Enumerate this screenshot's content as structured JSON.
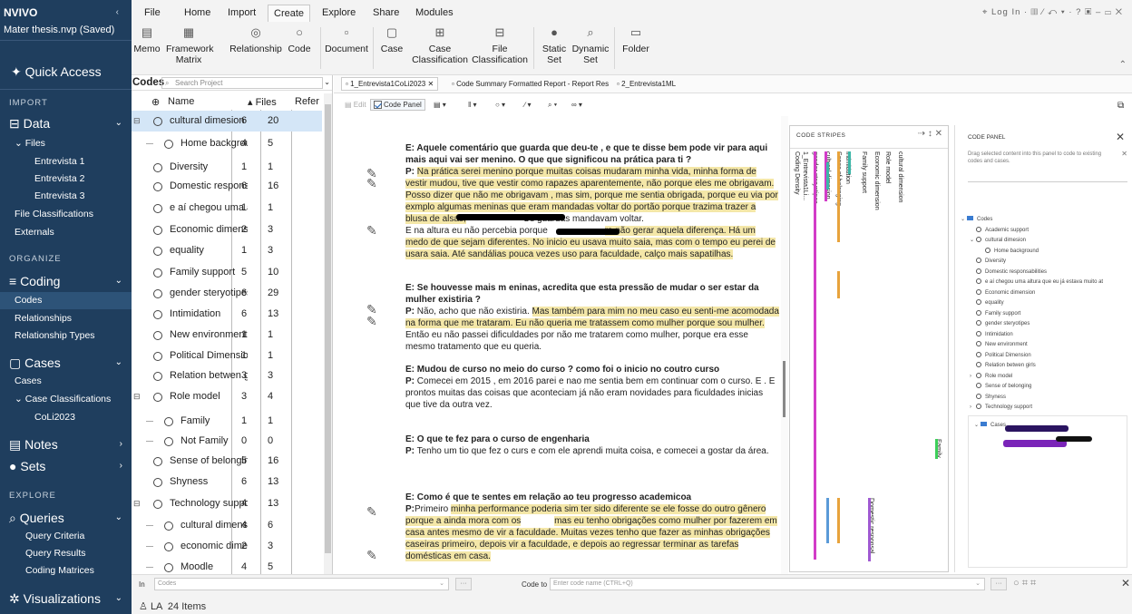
{
  "nav": {
    "logo": "NVIVO",
    "project": "Mater thesis.nvp (Saved)",
    "quick_access": "Quick Access",
    "sections": {
      "import": "IMPORT",
      "organize": "ORGANIZE",
      "explore": "EXPLORE"
    },
    "data": {
      "label": "Data",
      "files_label": "Files",
      "items": [
        "Entrevista 1",
        "Entrevista 2",
        "Entrevista 3"
      ],
      "file_classifications": "File Classifications",
      "externals": "Externals"
    },
    "coding": {
      "label": "Coding",
      "items": [
        "Codes",
        "Relationships",
        "Relationship Types"
      ]
    },
    "cases": {
      "label": "Cases",
      "items": [
        "Cases"
      ],
      "case_classifications": "Case Classifications",
      "sub": "CoLi2023"
    },
    "notes": "Notes",
    "sets": "Sets",
    "queries": {
      "label": "Queries",
      "items": [
        "Query Criteria",
        "Query Results",
        "Coding Matrices"
      ]
    },
    "visualizations": "Visualizations"
  },
  "ribbon": {
    "menus": [
      "File",
      "Home",
      "Import",
      "Create",
      "Explore",
      "Share",
      "Modules"
    ],
    "active_menu": "Create",
    "tools": [
      {
        "line1": "Memo",
        "line2": ""
      },
      {
        "line1": "Framework",
        "line2": "Matrix"
      },
      {
        "line1": "Relationship",
        "line2": ""
      },
      {
        "line1": "Code",
        "line2": ""
      },
      {
        "line1": "Document",
        "line2": ""
      },
      {
        "line1": "Case",
        "line2": ""
      },
      {
        "line1": "Case",
        "line2": "Classification"
      },
      {
        "line1": "File",
        "line2": "Classification"
      },
      {
        "line1": "Static",
        "line2": "Set"
      },
      {
        "line1": "Dynamic",
        "line2": "Set"
      },
      {
        "line1": "Folder",
        "line2": ""
      }
    ],
    "login": "Log In"
  },
  "codes": {
    "title": "Codes",
    "search_placeholder": "Search Project",
    "col_name": "Name",
    "col_files": "Files",
    "col_refs": "Refer",
    "rows": [
      {
        "name": "cultural dimesion",
        "files": "6",
        "refs": "20"
      },
      {
        "name": "Home backgrou",
        "files": "4",
        "refs": "5"
      },
      {
        "name": "Diversity",
        "files": "1",
        "refs": "1"
      },
      {
        "name": "Domestic responsab",
        "files": "6",
        "refs": "16"
      },
      {
        "name": "e aí chegou uma alt",
        "files": "1",
        "refs": "1"
      },
      {
        "name": "Economic dimension",
        "files": "2",
        "refs": "3"
      },
      {
        "name": "equality",
        "files": "1",
        "refs": "3"
      },
      {
        "name": "Family support",
        "files": "5",
        "refs": "10"
      },
      {
        "name": "gender steryotipes",
        "files": "6",
        "refs": "29"
      },
      {
        "name": "Intimidation",
        "files": "6",
        "refs": "13"
      },
      {
        "name": "New environment",
        "files": "1",
        "refs": "1"
      },
      {
        "name": "Political Dimension",
        "files": "1",
        "refs": "1"
      },
      {
        "name": "Relation betwen girl",
        "files": "3",
        "refs": "3"
      },
      {
        "name": "Role model",
        "files": "3",
        "refs": "4"
      },
      {
        "name": "Family",
        "files": "1",
        "refs": "1"
      },
      {
        "name": "Not Family",
        "files": "0",
        "refs": "0"
      },
      {
        "name": "Sense of belonging",
        "files": "5",
        "refs": "16"
      },
      {
        "name": "Shyness",
        "files": "6",
        "refs": "13"
      },
      {
        "name": "Technology support",
        "files": "4",
        "refs": "13"
      },
      {
        "name": "cultural dimensi",
        "files": "4",
        "refs": "6"
      },
      {
        "name": "economic dimen",
        "files": "2",
        "refs": "3"
      },
      {
        "name": "Moodle",
        "files": "4",
        "refs": "5"
      }
    ]
  },
  "doc_tabs": [
    "1_Entrevista1CoLi2023",
    "Code Summary Formatted Report - Report Res",
    "2_Entrevista1ML"
  ],
  "doc_toolbar": {
    "edit": "Edit",
    "code_panel": "Code Panel"
  },
  "document": [
    {
      "q": "E: Aquele comentário que guarda que deu-te , e que te disse bem pode vir para aqui mais aqui vai ser menino. O que que significou na prática para ti ?",
      "a_label": "P:",
      "a_hl": "Na prática serei menino porque muitas coisas mudaram minha vida, minha forma de vestir mudou, tive que vestir como rapazes aparentemente, não porque eles me obrigavam. Posso dizer que não me obrigavam , mas sim, porque me sentia obrigada, porque eu via por exmplo algumas meninas que eram mandadas voltar do portão porque trazima  trazer a blusa de alsas,",
      "a_tail": "Os guardas mandavam voltar."
    },
    {
      "a_pre": "E na altura eu não percebia porque",
      "a_hl": "ra não gerar aquela diferença. Há um medo de que sejam diferentes. No inicio eu usava muito saia, mas com o tempo eu perei de usara saia. Até sandálias pouca vezes uso para faculdade, calço mais sapatilhas."
    },
    {
      "q": "E: Se houvesse mais m eninas, acredita que esta pressão de mudar o ser estar da mulher existiria ?",
      "a_label": "P:",
      "a_pre": "Não, acho que não existiria.",
      "a_hl": "Mas também para mim no meu caso eu senti-me acomodada na forma que me trataram. Eu não queria me tratassem como mulher porque sou mulher.",
      "a_tail": "Então eu não passei dificuldades por não me tratarem como mulher, porque era esse mesmo tratamento que eu queria."
    },
    {
      "q": "E: Mudou de curso no meio do curso ? como foi o inicio no coutro curso",
      "a_label": "P:",
      "a_pre": "Comecei em 2015",
      "a_tail": ", em 2016 parei  e nao me sentia bem em continuar com o curso. E . E prontos muitas das coisas que aconteciam já não eram novidades para ficuldades inicias que tive da outra vez."
    },
    {
      "q": "E: O que te fez     para o curso de engenharia",
      "a_label": "P:",
      "a_tail": "Tenho um tio que fez  o curs e com ele aprendi muita coisa, e comecei a gostar da área."
    },
    {
      "q": "E: Como é que te sentes em relação ao teu progresso academicoa",
      "a_label": "P:",
      "a_pre": "Primeiro",
      "a_hl": "minha performance poderia sim ter sido diferente se ele fosse do outro gênero porque a ainda mora com os",
      "a_hl2": "mas eu  tenho obrigações como mulher  por fazerem em casa antes mesmo de vir a  faculdade. Muitas vezes tenho que fazer as minhas obrigações caseiras primeiro, depois vir a faculdade, e depois ao regressar terminar as tarefas domésticas em casa."
    }
  ],
  "stripes": {
    "title": "CODE STRIPES",
    "labels": [
      "Coding Density",
      "1_Entrevista1Li...",
      "gender steryotipes",
      "cultural dimesion",
      "Sense of belonging",
      "Intimidation",
      "Family support",
      "Economic dimension",
      "Role model",
      "cultural dimension",
      "Family",
      "Domestic responsal"
    ]
  },
  "code_panel": {
    "title": "CODE PANEL",
    "description": "Drag selected content into this panel to code to existing codes and cases.",
    "tree": [
      {
        "label": "Codes",
        "type": "folder",
        "level": 0
      },
      {
        "label": "Academic support",
        "type": "code",
        "level": 1
      },
      {
        "label": "cultural dimesion",
        "type": "code",
        "level": 1,
        "expanded": true
      },
      {
        "label": "Home background",
        "type": "code",
        "level": 2
      },
      {
        "label": "Diversity",
        "type": "code",
        "level": 1
      },
      {
        "label": "Domestic responsabilities",
        "type": "code",
        "level": 1
      },
      {
        "label": "e aí chegou uma altura que eu já estava muito at",
        "type": "code",
        "level": 1
      },
      {
        "label": "Economic dimension",
        "type": "code",
        "level": 1
      },
      {
        "label": "equality",
        "type": "code",
        "level": 1
      },
      {
        "label": "Family support",
        "type": "code",
        "level": 1
      },
      {
        "label": "gender steryotipes",
        "type": "code",
        "level": 1
      },
      {
        "label": "Intimidation",
        "type": "code",
        "level": 1
      },
      {
        "label": "New environment",
        "type": "code",
        "level": 1
      },
      {
        "label": "Political Dimension",
        "type": "code",
        "level": 1
      },
      {
        "label": "Relation betwen girls",
        "type": "code",
        "level": 1
      },
      {
        "label": "Role model",
        "type": "code",
        "level": 1,
        "collapsed": true
      },
      {
        "label": "Sense of belonging",
        "type": "code",
        "level": 1
      },
      {
        "label": "Shyness",
        "type": "code",
        "level": 1
      },
      {
        "label": "Technology support",
        "type": "code",
        "level": 1,
        "collapsed": true
      }
    ],
    "cases_label": "Cases"
  },
  "bottom": {
    "in_label": "In",
    "in_value": "Codes",
    "code_to_label": "Code to",
    "code_to_placeholder": "Enter code name (CTRL+Q)",
    "status_user": "LA",
    "status_items": "24 Items"
  },
  "colors": {
    "nav_bg": "#1f3e5e",
    "highlight": "#f4e7a8",
    "selection": "#d4e6f7",
    "stripe_magenta": "#d23cc8",
    "stripe_orange": "#e8a33c",
    "stripe_teal": "#3bb6a8",
    "stripe_purple": "#a05ad2",
    "stripe_green": "#3dcf5a",
    "stripe_blue": "#5a9ad8"
  }
}
